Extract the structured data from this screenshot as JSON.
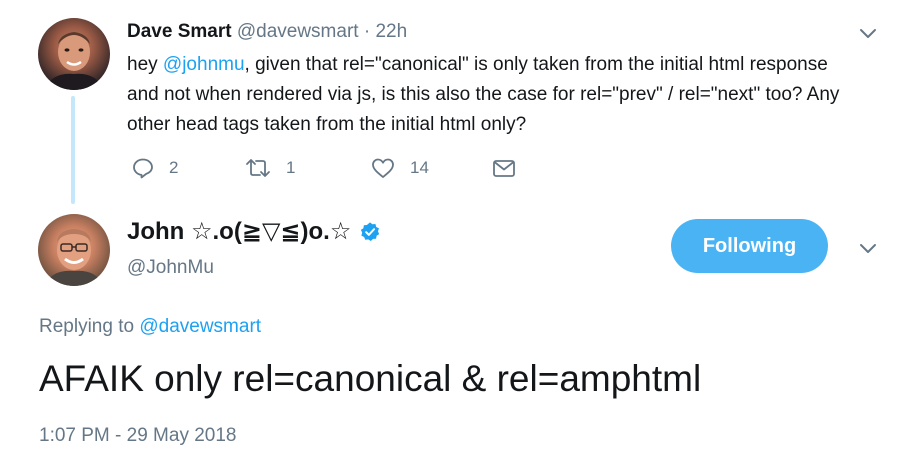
{
  "original_tweet": {
    "author_name": "Dave Smart",
    "author_handle": "@davewsmart",
    "separator": "·",
    "time": "22h",
    "text_before": "hey ",
    "mention": "@johnmu",
    "text_after": ", given that rel=\"canonical\" is only taken from the initial html response and not when rendered via js, is this also the case for rel=\"prev\" / rel=\"next\" too? Any other head tags taken from the initial html only?",
    "actions": {
      "reply_count": "2",
      "retweet_count": "1",
      "like_count": "14"
    },
    "icons": [
      "reply-icon",
      "retweet-icon",
      "like-icon",
      "direct-message-icon",
      "chevron-down-icon"
    ]
  },
  "reply_tweet": {
    "author_name": "John ☆.o(≧▽≦)o.☆",
    "author_handle": "@JohnMu",
    "verified": true,
    "follow_button_label": "Following",
    "replying_to_label": "Replying to ",
    "replying_to_handle": "@davewsmart",
    "text": "AFAIK only rel=canonical & rel=amphtml",
    "timestamp": "1:07 PM - 29 May 2018"
  },
  "colors": {
    "accent": "#1da1f2",
    "follow_button": "#4ab3f4",
    "muted_text": "#657786",
    "thread_line": "#c4e7fb"
  }
}
